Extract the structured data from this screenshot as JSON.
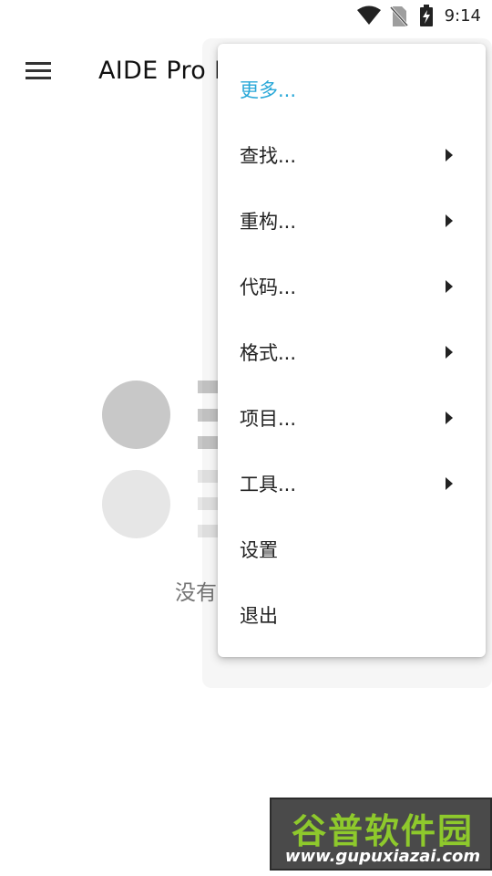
{
  "status_bar": {
    "time": "9:14",
    "icons": [
      "wifi-icon",
      "no-sim-icon",
      "battery-charging-icon"
    ]
  },
  "app_bar": {
    "title": "AIDE Pro I",
    "menu_icon": "hamburger-menu-icon"
  },
  "empty_state": {
    "text": "没有"
  },
  "popup_menu": {
    "items": [
      {
        "label": "更多...",
        "submenu": false,
        "accent": true
      },
      {
        "label": "查找...",
        "submenu": true
      },
      {
        "label": "重构...",
        "submenu": true
      },
      {
        "label": "代码...",
        "submenu": true
      },
      {
        "label": "格式...",
        "submenu": true
      },
      {
        "label": "项目...",
        "submenu": true
      },
      {
        "label": "工具...",
        "submenu": true
      },
      {
        "label": "设置",
        "submenu": false
      },
      {
        "label": "退出",
        "submenu": false
      }
    ]
  },
  "watermark": {
    "title": "谷普软件园",
    "url": "www.gupuxiazai.com"
  },
  "colors": {
    "accent": "#29a8d8",
    "watermark_green": "#8ec92c",
    "placeholder_dark": "#c8c8c8",
    "placeholder_light": "#e6e6e6"
  }
}
